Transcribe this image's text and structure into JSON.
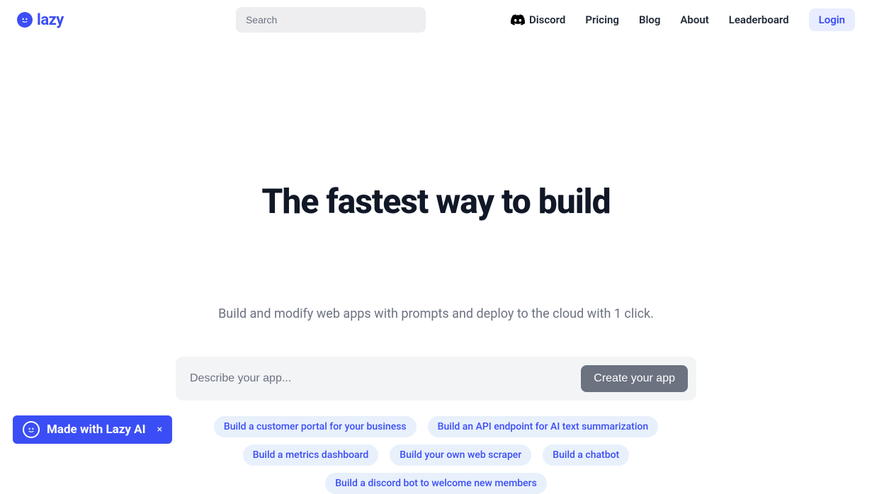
{
  "header": {
    "logo_text": "lazy",
    "search_placeholder": "Search",
    "nav": {
      "discord": "Discord",
      "pricing": "Pricing",
      "blog": "Blog",
      "about": "About",
      "leaderboard": "Leaderboard",
      "login": "Login"
    }
  },
  "hero": {
    "title": "The fastest way to build",
    "subtitle": "Build and modify web apps with prompts and deploy to the cloud with 1 click.",
    "prompt_placeholder": "Describe your app...",
    "create_button": "Create your app"
  },
  "suggestions": [
    "Build a customer portal for your business",
    "Build an API endpoint for AI text summarization",
    "Build a metrics dashboard",
    "Build your own web scraper",
    "Build a chatbot",
    "Build a discord bot to welcome new members"
  ],
  "badge": {
    "text": "Made with Lazy AI",
    "close": "×"
  }
}
